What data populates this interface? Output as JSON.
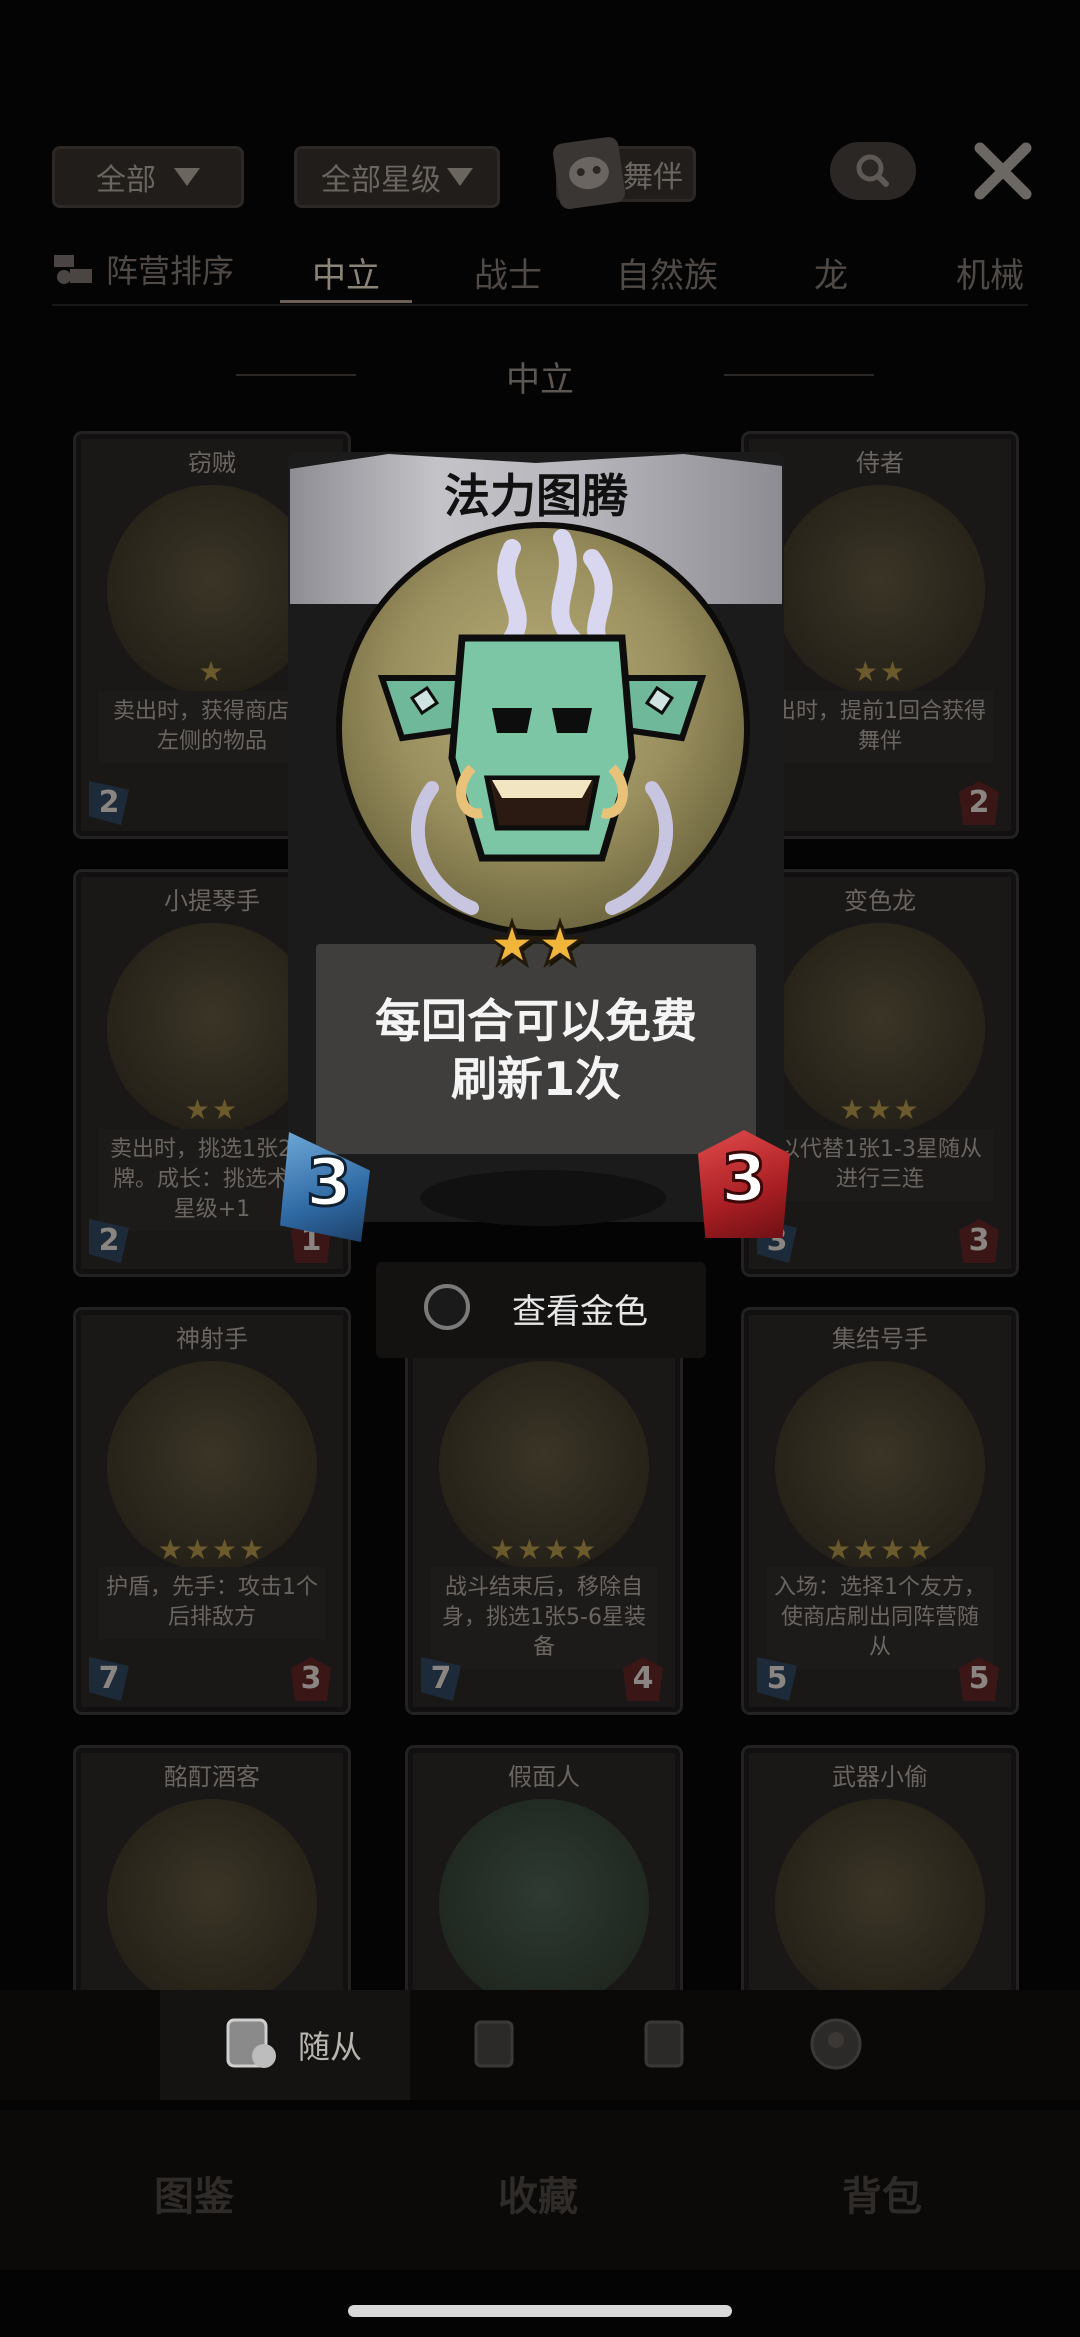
{
  "filters": {
    "faction_filter": "全部",
    "star_filter": "全部星级",
    "companion_filter": "舞伴"
  },
  "icons": {
    "search": "search-icon",
    "close": "close-icon",
    "sort": "sort-icon"
  },
  "tabs": {
    "sort_label": "阵营排序",
    "items": [
      "中立",
      "战士",
      "自然族",
      "龙",
      "机械"
    ],
    "active": "中立"
  },
  "section_title": "中立",
  "cards": [
    {
      "name": "窃贼",
      "stars": "★",
      "desc": "卖出时，获得商店最左侧的物品",
      "cost": "2",
      "atk": ""
    },
    {
      "name": "侍者",
      "stars": "★★",
      "desc": "出时，提前1回合获得舞伴",
      "cost": "",
      "atk": "2"
    },
    {
      "name": "小提琴手",
      "stars": "★★",
      "desc": "卖出时，挑选1张2术牌。成长：挑选术牌星级+1",
      "cost": "2",
      "atk": "1"
    },
    {
      "name": "变色龙",
      "stars": "★★★",
      "desc": "以代替1张1-3星随从进行三连",
      "cost": "3",
      "atk": "3"
    },
    {
      "name": "神射手",
      "stars": "★★★★",
      "desc": "护盾，先手：攻击1个后排敌方",
      "cost": "7",
      "atk": "3"
    },
    {
      "name": "",
      "stars": "★★★★",
      "desc": "战斗结束后，移除自身，挑选1张5-6星装备",
      "cost": "7",
      "atk": "4"
    },
    {
      "name": "集结号手",
      "stars": "★★★★",
      "desc": "入场：选择1个友方，使商店刷出同阵营随从",
      "cost": "5",
      "atk": "5"
    },
    {
      "name": "酩酊酒客",
      "stars": "",
      "desc": "",
      "cost": "",
      "atk": ""
    },
    {
      "name": "假面人",
      "stars": "",
      "desc": "",
      "cost": "",
      "atk": ""
    },
    {
      "name": "武器小偷",
      "stars": "",
      "desc": "",
      "cost": "",
      "atk": ""
    }
  ],
  "featured_card": {
    "name": "法力图腾",
    "star_count": 2,
    "description_line1": "每回合可以免费",
    "description_line2": "刷新1次",
    "cost": "3",
    "attack": "3"
  },
  "toggle_label": "查看金色",
  "sub_nav": {
    "active_label": "随从"
  },
  "main_nav": [
    "图鉴",
    "收藏",
    "背包"
  ]
}
